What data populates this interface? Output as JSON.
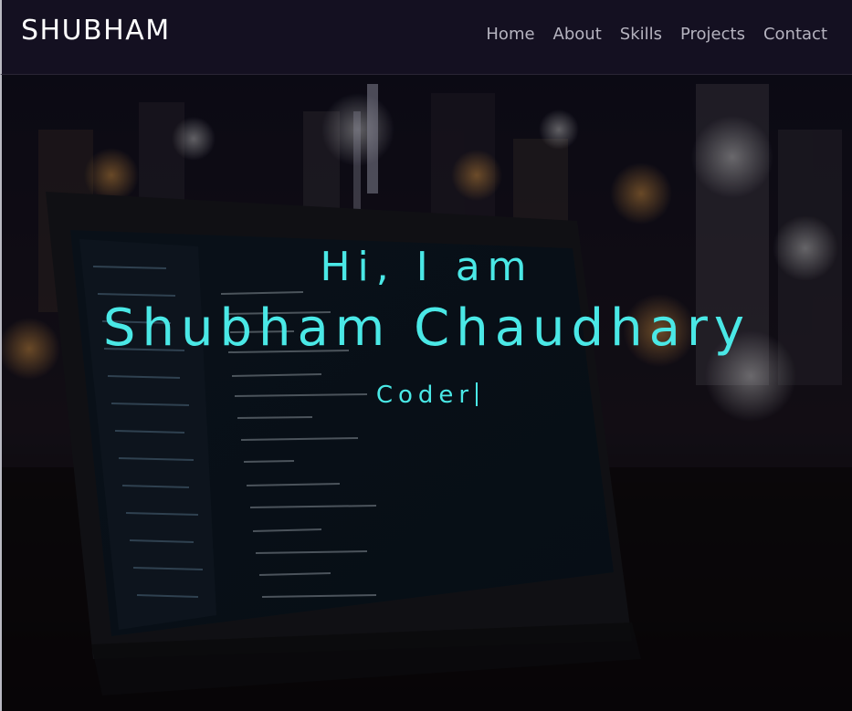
{
  "navbar": {
    "brand": "SHUBHAM",
    "links": [
      {
        "label": "Home"
      },
      {
        "label": "About"
      },
      {
        "label": "Skills"
      },
      {
        "label": "Projects"
      },
      {
        "label": "Contact"
      }
    ]
  },
  "hero": {
    "greeting": "Hi, I am",
    "name": "Shubham Chaudhary",
    "role": "Coder",
    "accent_color": "#4ae8e6",
    "background_image": "laptop-with-code-city-night-photo"
  }
}
